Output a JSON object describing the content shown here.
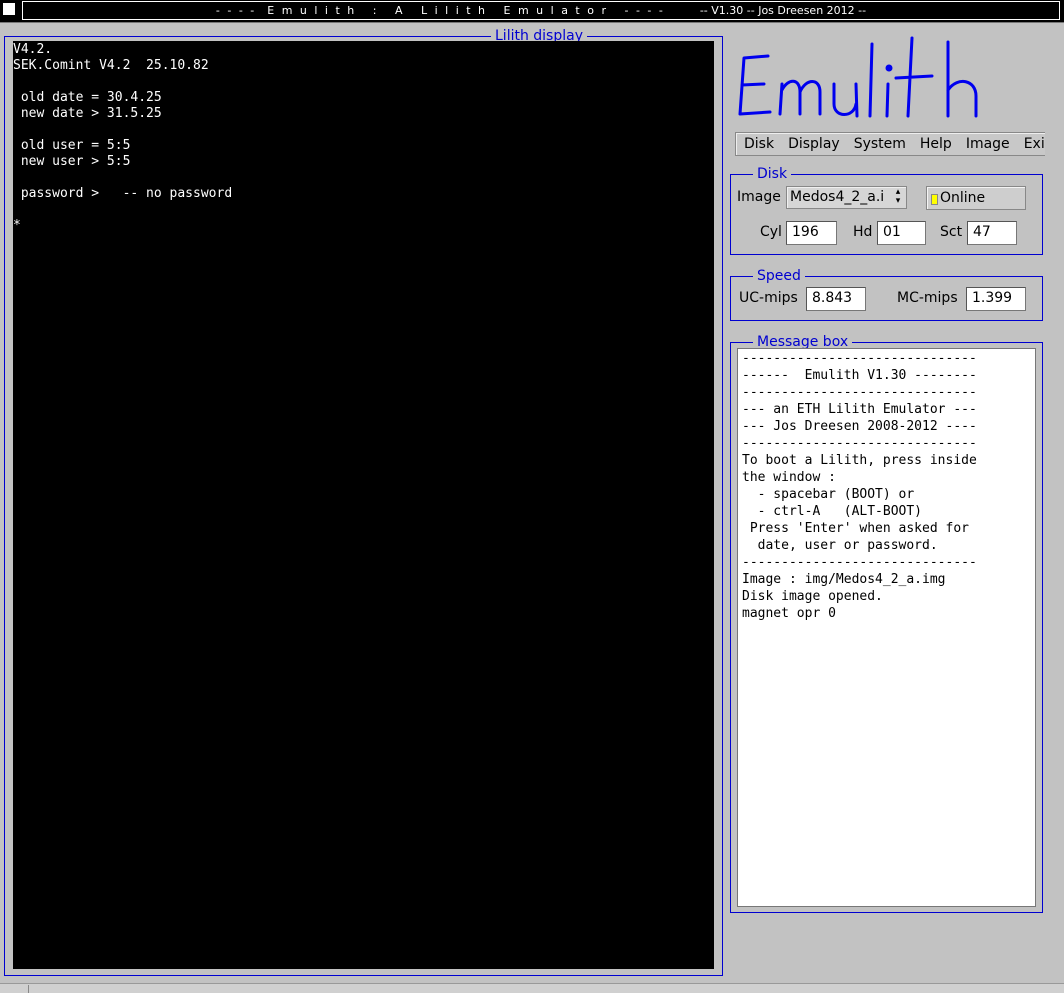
{
  "window": {
    "title": "- - - -  E m u l i t h   :   A   L i l i t h   E m u l a t o r   - - - -",
    "version_text": "-- V1.30 -- Jos Dreesen 2012 --"
  },
  "display": {
    "legend": "Lilith display",
    "lines": [
      "V4.2.",
      "SEK.Comint V4.2  25.10.82",
      "",
      " old date = 30.4.25",
      " new date > 31.5.25",
      "",
      " old user = 5:5",
      " new user > 5:5",
      "",
      " password >   -- no password",
      "",
      "*"
    ]
  },
  "logo": {
    "text": "Emulith",
    "color": "#0000ee"
  },
  "menu": {
    "items": [
      "Disk",
      "Display",
      "System",
      "Help",
      "Image",
      "Exit"
    ]
  },
  "disk": {
    "legend": "Disk",
    "image_label": "Image",
    "image_value": "Medos4_2_a.i",
    "online_label": "Online",
    "online_led_color": "#ffff00",
    "cyl_label": "Cyl",
    "cyl_value": "196",
    "hd_label": "Hd",
    "hd_value": "01",
    "sct_label": "Sct",
    "sct_value": "47"
  },
  "speed": {
    "legend": "Speed",
    "uc_label": "UC-mips",
    "uc_value": "8.843",
    "mc_label": "MC-mips",
    "mc_value": "1.399"
  },
  "message_box": {
    "legend": "Message box",
    "lines": [
      "------------------------------",
      "------  Emulith V1.30 --------",
      "------------------------------",
      "--- an ETH Lilith Emulator ---",
      "--- Jos Dreesen 2008-2012 ----",
      "------------------------------",
      "To boot a Lilith, press inside",
      "the window :",
      "  - spacebar (BOOT) or",
      "  - ctrl-A   (ALT-BOOT)",
      " Press 'Enter' when asked for",
      "  date, user or password.",
      "------------------------------",
      "Image : img/Medos4_2_a.img",
      "Disk image opened.",
      "magnet opr 0"
    ]
  },
  "colors": {
    "accent": "#0000d0",
    "background": "#c2c2c2",
    "screen": "#000000"
  }
}
